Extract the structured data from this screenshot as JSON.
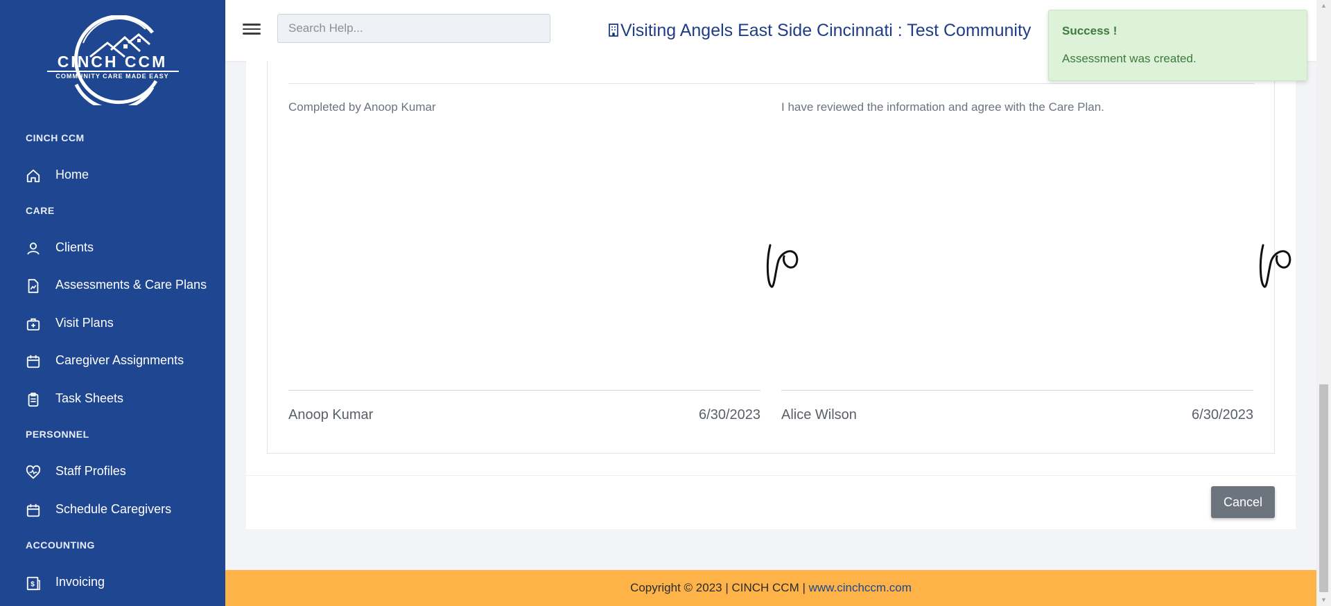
{
  "sidebar": {
    "logo": {
      "name": "CINCH CCM",
      "tagline": "COMMUNITY CARE MADE EASY"
    },
    "sections": {
      "cinch": "CINCH CCM",
      "care": "CARE",
      "personnel": "PERSONNEL",
      "accounting": "ACCOUNTING"
    },
    "items": {
      "home": {
        "label": "Home",
        "icon": "home-icon"
      },
      "clients": {
        "label": "Clients",
        "icon": "user-icon"
      },
      "assessments": {
        "label": "Assessments & Care Plans",
        "icon": "document-chart-icon"
      },
      "visit_plans": {
        "label": "Visit Plans",
        "icon": "briefcase-plus-icon"
      },
      "caregiver_assignments": {
        "label": "Caregiver Assignments",
        "icon": "calendar-icon"
      },
      "task_sheets": {
        "label": "Task Sheets",
        "icon": "clipboard-icon"
      },
      "staff_profiles": {
        "label": "Staff Profiles",
        "icon": "heart-pulse-icon"
      },
      "schedule_caregivers": {
        "label": "Schedule Caregivers",
        "icon": "calendar-icon"
      },
      "invoicing": {
        "label": "Invoicing",
        "icon": "invoice-icon"
      }
    },
    "background": "#1f4690"
  },
  "topbar": {
    "search": {
      "placeholder": "Search Help...",
      "value": ""
    },
    "agency_title": "Visiting Angels East Side Cincinnati : Test Community"
  },
  "signatures": {
    "left": {
      "caption": "Completed by Anoop Kumar",
      "name": "Anoop Kumar",
      "date": "6/30/2023"
    },
    "right": {
      "caption": "I have reviewed the information and agree with the Care Plan.",
      "name": "Alice Wilson",
      "date": "6/30/2023"
    }
  },
  "actions": {
    "cancel_label": "Cancel"
  },
  "toast": {
    "title": "Success !",
    "message": "Assessment was created.",
    "color": "#def2d9"
  },
  "footer": {
    "text": "Copyright © 2023 | CINCH CCM | ",
    "link": "www.cinchccm.com",
    "color": "#fdb347"
  }
}
